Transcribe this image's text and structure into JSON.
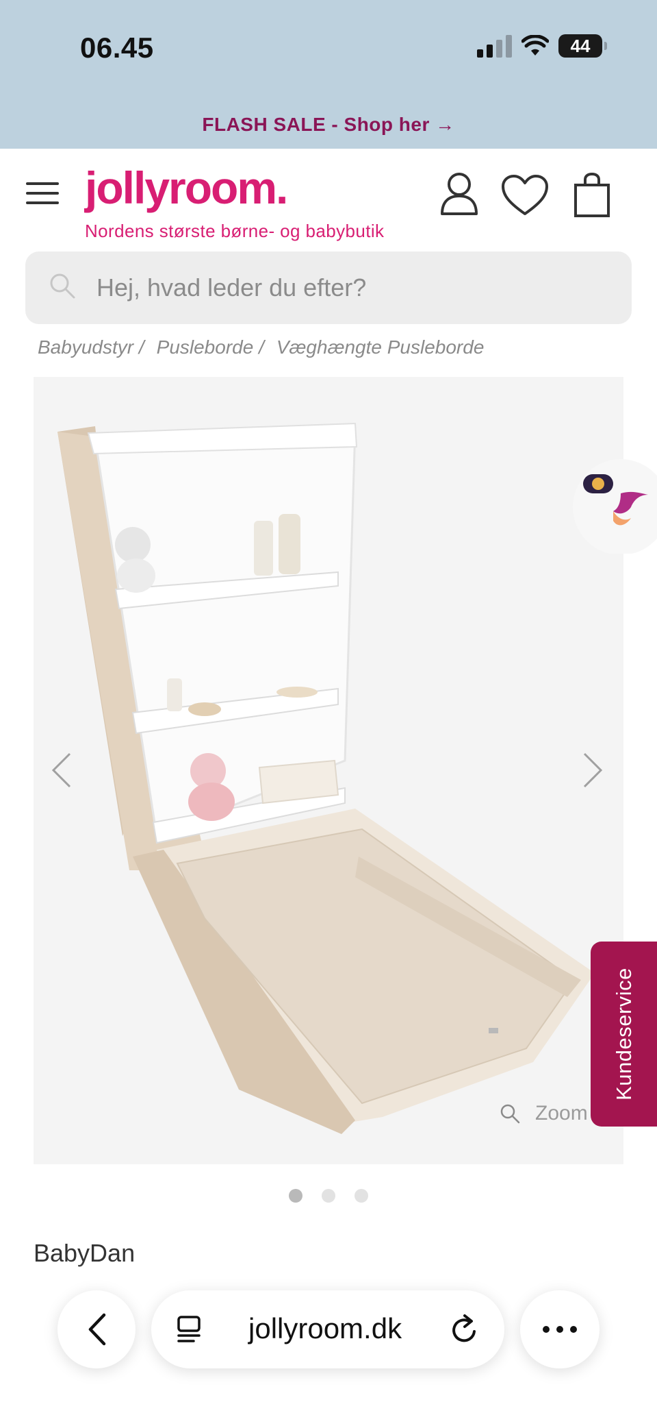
{
  "status": {
    "time": "06.45",
    "battery": "44"
  },
  "banner": {
    "flash_sale": "FLASH SALE - Shop her →"
  },
  "header": {
    "logo": "jollyroom.",
    "tagline": "Nordens største børne- og babybutik"
  },
  "search": {
    "placeholder": "Hej, hvad leder du efter?"
  },
  "breadcrumb": [
    "Babyudstyr /",
    "Pusleborde /",
    "Væghængte Pusleborde"
  ],
  "gallery": {
    "zoom_label": "Zoom",
    "slides": 3,
    "active_slide": 1
  },
  "product": {
    "brand": "BabyDan"
  },
  "support": {
    "label": "Kundeservice"
  },
  "browser": {
    "url": "jollyroom.dk"
  },
  "colors": {
    "brand_pink": "#d81e73",
    "banner_bg": "#bdd1de",
    "support_bg": "#a3154f"
  }
}
